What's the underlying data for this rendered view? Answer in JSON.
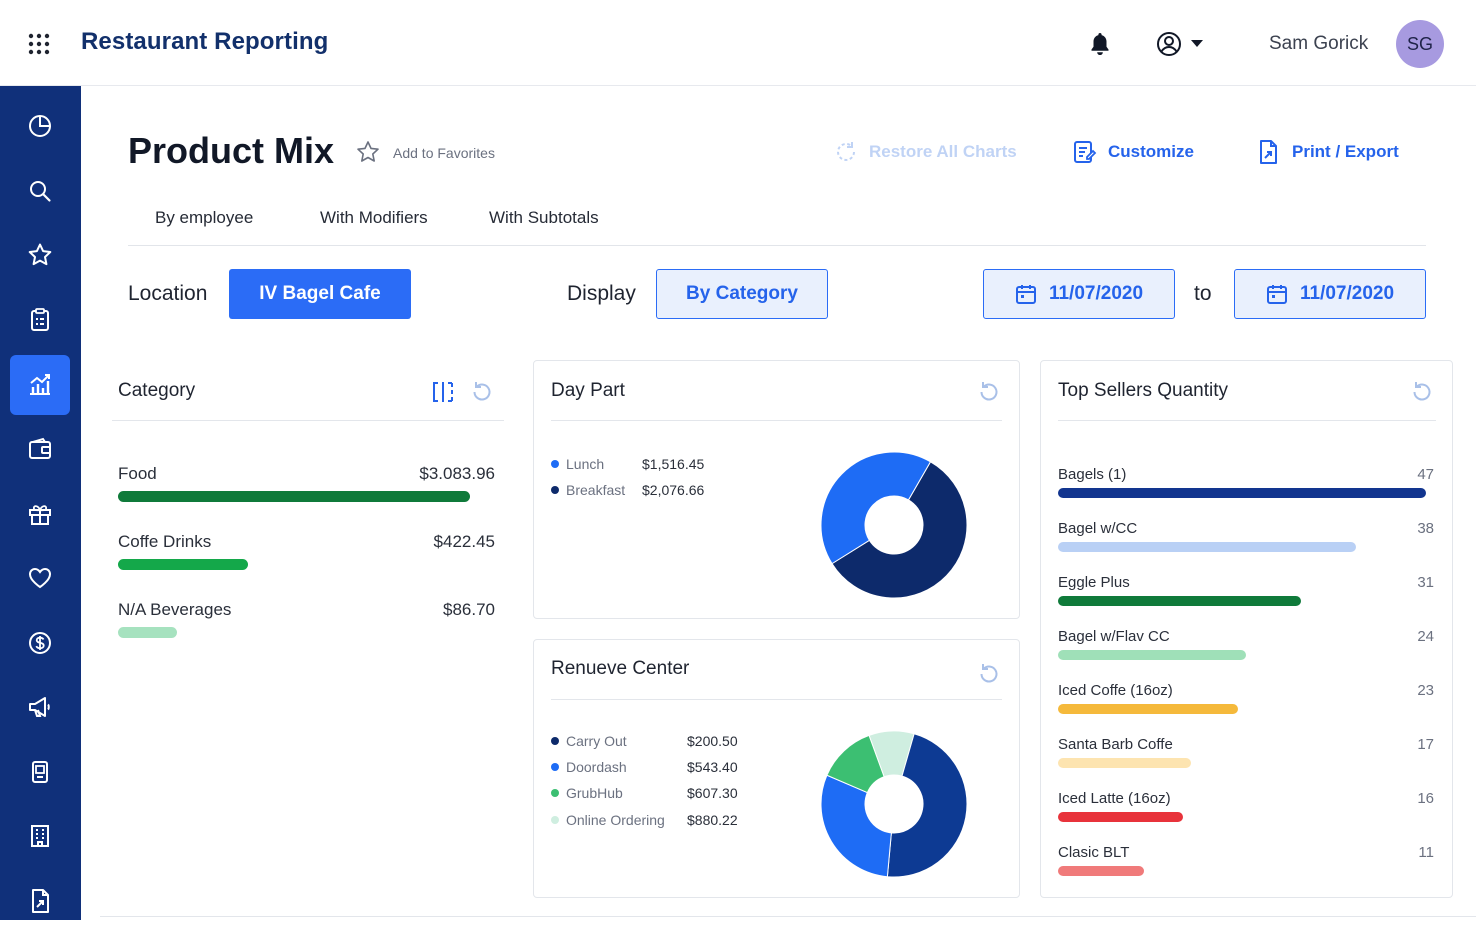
{
  "header": {
    "app_title": "Restaurant Reporting",
    "user_name": "Sam Gorick",
    "user_initials": "SG"
  },
  "sidebar": {
    "items": [
      {
        "icon": "pie-chart-icon"
      },
      {
        "icon": "search-icon"
      },
      {
        "icon": "star-icon"
      },
      {
        "icon": "clipboard-icon"
      },
      {
        "icon": "analytics-icon",
        "active": true
      },
      {
        "icon": "wallet-icon"
      },
      {
        "icon": "gift-icon"
      },
      {
        "icon": "heart-icon"
      },
      {
        "icon": "dollar-icon"
      },
      {
        "icon": "megaphone-icon"
      },
      {
        "icon": "device-icon"
      },
      {
        "icon": "building-icon"
      },
      {
        "icon": "document-icon"
      }
    ]
  },
  "page": {
    "title": "Product Mix",
    "add_to_favorites": "Add to Favorites",
    "actions": {
      "restore": "Restore All Charts",
      "customize": "Customize",
      "print_export": "Print / Export"
    },
    "tabs": [
      "By employee",
      "With Modifiers",
      "With Subtotals"
    ]
  },
  "filters": {
    "location_label": "Location",
    "location_value": "IV Bagel Cafe",
    "display_label": "Display",
    "display_value": "By Category",
    "date_from": "11/07/2020",
    "to_label": "to",
    "date_to": "11/07/2020"
  },
  "category_card": {
    "title": "Category",
    "rows": [
      {
        "name": "Food",
        "value": "$3.083.96",
        "amount": 3083.96,
        "color": "#0f7a3a"
      },
      {
        "name": "Coffe Drinks",
        "value": "$422.45",
        "amount": 422.45,
        "color": "#14a84a"
      },
      {
        "name": "N/A Beverages",
        "value": "$86.70",
        "amount": 86.7,
        "color": "#a6e2bf"
      }
    ]
  },
  "daypart_card": {
    "title": "Day Part",
    "legend": [
      {
        "label": "Lunch",
        "value": "$1,516.45",
        "amount": 1516.45,
        "color": "#1e6cf5"
      },
      {
        "label": "Breakfast",
        "value": "$2,076.66",
        "amount": 2076.66,
        "color": "#0d2a6b"
      }
    ]
  },
  "revenue_card": {
    "title": "Renueve Center",
    "legend": [
      {
        "label": "Carry Out",
        "value": "$200.50",
        "amount": 200.5,
        "color": "#0d2a6b"
      },
      {
        "label": "Doordash",
        "value": "$543.40",
        "amount": 543.4,
        "color": "#1e6cf5"
      },
      {
        "label": "GrubHub",
        "value": "$607.30",
        "amount": 607.3,
        "color": "#3cbf72"
      },
      {
        "label": "Online Ordering",
        "value": "$880.22",
        "amount": 880.22,
        "color": "#cfeee0"
      }
    ],
    "slices": [
      {
        "label": "Online Ordering",
        "percent": 10,
        "color": "#cfeee0"
      },
      {
        "label": "Carry Out",
        "percent": 47,
        "color": "#0d3a93"
      },
      {
        "label": "Doordash",
        "percent": 30,
        "color": "#1e6cf5"
      },
      {
        "label": "GrubHub",
        "percent": 13,
        "color": "#3cbf72"
      }
    ]
  },
  "top_sellers_card": {
    "title": "Top Sellers Quantity",
    "max": 47,
    "items": [
      {
        "name": "Bagels (1)",
        "qty": 47,
        "color": "#12358f"
      },
      {
        "name": "Bagel w/CC",
        "qty": 38,
        "color": "#b9d0f5"
      },
      {
        "name": "Eggle Plus",
        "qty": 31,
        "color": "#0f7a3a"
      },
      {
        "name": "Bagel w/Flav CC",
        "qty": 24,
        "color": "#9fe0b8"
      },
      {
        "name": "Iced Coffe (16oz)",
        "qty": 23,
        "color": "#f5b93b"
      },
      {
        "name": "Santa Barb Coffe",
        "qty": 17,
        "color": "#fde4b0"
      },
      {
        "name": "Iced Latte (16oz)",
        "qty": 16,
        "color": "#e8333b"
      },
      {
        "name": "Clasic BLT",
        "qty": 11,
        "color": "#f07a7a"
      }
    ]
  }
}
